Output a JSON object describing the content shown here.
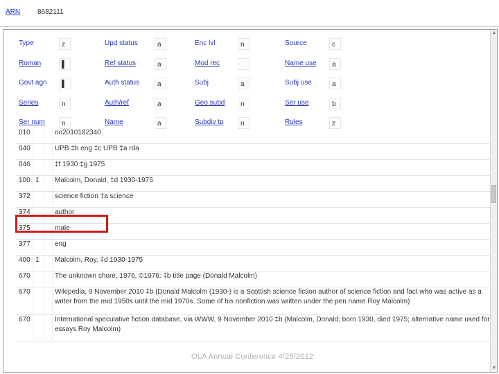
{
  "header": {
    "arn_label": "ARN",
    "arn_value": "8682111"
  },
  "fixed_fields": [
    [
      {
        "label": "Type",
        "value": "z",
        "link": false
      },
      {
        "label": "Upd status",
        "value": "a",
        "link": false
      },
      {
        "label": "Enc lvl",
        "value": "n",
        "link": false
      },
      {
        "label": "Source",
        "value": "c",
        "link": false
      }
    ],
    [
      {
        "label": "Roman",
        "value": "▌",
        "link": true
      },
      {
        "label": "Ref status",
        "value": "a",
        "link": true
      },
      {
        "label": "Mod rec",
        "value": "",
        "link": true
      },
      {
        "label": "Name use",
        "value": "a",
        "link": true
      }
    ],
    [
      {
        "label": "Govt agn",
        "value": "▌",
        "link": false
      },
      {
        "label": "Auth status",
        "value": "a",
        "link": false
      },
      {
        "label": "Subj",
        "value": "a",
        "link": false
      },
      {
        "label": "Subj use",
        "value": "a",
        "link": false
      }
    ],
    [
      {
        "label": "Series",
        "value": "n",
        "link": true
      },
      {
        "label": "Auth/ref",
        "value": "a",
        "link": true
      },
      {
        "label": "Geo subd",
        "value": "n",
        "link": true
      },
      {
        "label": "Ser use",
        "value": "b",
        "link": true
      }
    ],
    [
      {
        "label": "Ser num",
        "value": "n",
        "link": true
      },
      {
        "label": "Name",
        "value": "a",
        "link": true
      },
      {
        "label": "Subdiv tp",
        "value": "n",
        "link": true
      },
      {
        "label": "Rules",
        "value": "z",
        "link": true
      }
    ]
  ],
  "variable_fields": [
    {
      "tag": "010",
      "ind1": "",
      "ind2": "",
      "content": "no2010182340"
    },
    {
      "tag": "040",
      "ind1": "",
      "ind2": "",
      "content": "UPB ‡b eng ‡c UPB ‡a rda"
    },
    {
      "tag": "046",
      "ind1": "",
      "ind2": "",
      "content": "‡f 1930 ‡g 1975"
    },
    {
      "tag": "100",
      "ind1": "1",
      "ind2": "",
      "content": "Malcolm, Donald, ‡d 1930-1975"
    },
    {
      "tag": "372",
      "ind1": "",
      "ind2": "",
      "content": "science fiction ‡a science"
    },
    {
      "tag": "374",
      "ind1": "",
      "ind2": "",
      "content": "author"
    },
    {
      "tag": "375",
      "ind1": "",
      "ind2": "",
      "content": "male"
    },
    {
      "tag": "377",
      "ind1": "",
      "ind2": "",
      "content": "eng"
    },
    {
      "tag": "400",
      "ind1": "1",
      "ind2": "",
      "content": "Malcolm, Roy, ‡d 1930-1975"
    },
    {
      "tag": "670",
      "ind1": "",
      "ind2": "",
      "content": "The unknown shore, 1976, ©1976: ‡b title page (Donald Malcolm)"
    },
    {
      "tag": "670",
      "ind1": "",
      "ind2": "",
      "content": "Wikipedia, 9 November 2010 ‡b (Donald Malcolm (1930-) is a Scottish science fiction author of science fiction and fact who was active as a writer from the mid 1950s until the mid 1970s. Some of his nonfiction was written under the pen name Roy Malcolm)"
    },
    {
      "tag": "670",
      "ind1": "",
      "ind2": "",
      "content": "International speculative fiction database, via WWW, 9 November 2010 ‡b (Malcolm, Donald; born 1930, died 1975; alternative name used for essays Roy Malcolm)"
    }
  ],
  "footer": "OLA Annual Conference 4/25/2012"
}
